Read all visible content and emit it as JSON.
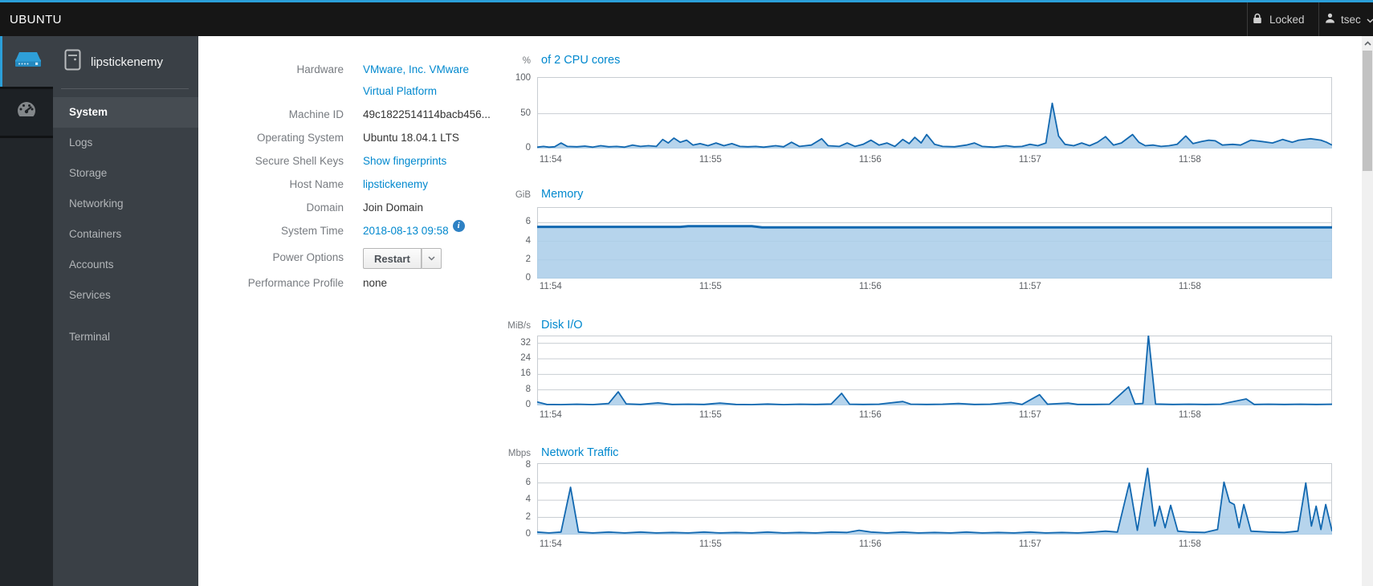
{
  "topbar": {
    "brand": "UBUNTU",
    "locked_label": "Locked",
    "user_label": "tsec"
  },
  "sidebar": {
    "host": "lipstickenemy",
    "items": [
      {
        "label": "System",
        "active": true
      },
      {
        "label": "Logs"
      },
      {
        "label": "Storage"
      },
      {
        "label": "Networking"
      },
      {
        "label": "Containers"
      },
      {
        "label": "Accounts"
      },
      {
        "label": "Services"
      },
      {
        "label": "Terminal",
        "separated": true
      }
    ]
  },
  "system": {
    "rows": [
      {
        "name": "hardware",
        "label": "Hardware",
        "value": "VMware, Inc. VMware Virtual Platform",
        "type": "link",
        "wrap": true
      },
      {
        "name": "machine-id",
        "label": "Machine ID",
        "value": "49c1822514114bacb456...",
        "type": "text"
      },
      {
        "name": "operating-system",
        "label": "Operating System",
        "value": "Ubuntu 18.04.1 LTS",
        "type": "text"
      },
      {
        "name": "secure-shell-keys",
        "label": "Secure Shell Keys",
        "value": "Show fingerprints",
        "type": "link"
      },
      {
        "name": "host-name",
        "label": "Host Name",
        "value": "lipstickenemy",
        "type": "link"
      },
      {
        "name": "domain",
        "label": "Domain",
        "value": "Join Domain",
        "type": "text"
      },
      {
        "name": "system-time",
        "label": "System Time",
        "value": "2018-08-13 09:58",
        "type": "link",
        "info_icon": true
      },
      {
        "name": "power-options",
        "label": "Power Options",
        "value": "Restart",
        "type": "button"
      },
      {
        "name": "performance-profile",
        "label": "Performance Profile",
        "value": "none",
        "type": "text"
      }
    ]
  },
  "colors": {
    "accent": "#2b9fd9",
    "link": "#0088ce",
    "chart_line": "#1268b0",
    "chart_fill": "#a9cce9",
    "chart_grid": "#c9ced3",
    "chart_border": "#c8cdd2"
  },
  "chart_data": [
    {
      "type": "area",
      "unit": "%",
      "title": "of 2 CPU cores",
      "ylim": [
        0,
        102.5
      ],
      "yticks": [
        100,
        50,
        0
      ],
      "gridlines": [
        50
      ],
      "line_width": 1.8,
      "xticks": {
        "labels": [
          "11:54",
          "11:55",
          "11:56",
          "11:57",
          "11:58"
        ],
        "t": [
          0.017,
          0.218,
          0.419,
          0.62,
          0.821
        ]
      },
      "series": [
        [
          0,
          2
        ],
        [
          0.008,
          3
        ],
        [
          0.015,
          2
        ],
        [
          0.022,
          2.5
        ],
        [
          0.03,
          8
        ],
        [
          0.038,
          3
        ],
        [
          0.05,
          2.5
        ],
        [
          0.06,
          3.5
        ],
        [
          0.07,
          2
        ],
        [
          0.08,
          4
        ],
        [
          0.09,
          2.5
        ],
        [
          0.1,
          3
        ],
        [
          0.11,
          2
        ],
        [
          0.12,
          5
        ],
        [
          0.13,
          3
        ],
        [
          0.14,
          4
        ],
        [
          0.15,
          3
        ],
        [
          0.158,
          13
        ],
        [
          0.165,
          8
        ],
        [
          0.172,
          15
        ],
        [
          0.18,
          9
        ],
        [
          0.188,
          12
        ],
        [
          0.196,
          5
        ],
        [
          0.205,
          7
        ],
        [
          0.215,
          4
        ],
        [
          0.225,
          8
        ],
        [
          0.235,
          4
        ],
        [
          0.245,
          7
        ],
        [
          0.255,
          3
        ],
        [
          0.265,
          2.5
        ],
        [
          0.275,
          3
        ],
        [
          0.285,
          2
        ],
        [
          0.3,
          4
        ],
        [
          0.31,
          2.5
        ],
        [
          0.32,
          9
        ],
        [
          0.33,
          3
        ],
        [
          0.345,
          5
        ],
        [
          0.358,
          14
        ],
        [
          0.366,
          4
        ],
        [
          0.38,
          3
        ],
        [
          0.39,
          8
        ],
        [
          0.4,
          3
        ],
        [
          0.41,
          6
        ],
        [
          0.42,
          12
        ],
        [
          0.43,
          5
        ],
        [
          0.44,
          8
        ],
        [
          0.45,
          3
        ],
        [
          0.46,
          13
        ],
        [
          0.468,
          7
        ],
        [
          0.475,
          16
        ],
        [
          0.483,
          8
        ],
        [
          0.49,
          20
        ],
        [
          0.5,
          6
        ],
        [
          0.51,
          3
        ],
        [
          0.525,
          2.5
        ],
        [
          0.54,
          5
        ],
        [
          0.55,
          8
        ],
        [
          0.56,
          3
        ],
        [
          0.575,
          2
        ],
        [
          0.59,
          4
        ],
        [
          0.6,
          2.5
        ],
        [
          0.61,
          3
        ],
        [
          0.62,
          6
        ],
        [
          0.63,
          4
        ],
        [
          0.64,
          8
        ],
        [
          0.648,
          65
        ],
        [
          0.656,
          18
        ],
        [
          0.664,
          6
        ],
        [
          0.675,
          4
        ],
        [
          0.685,
          8
        ],
        [
          0.695,
          4
        ],
        [
          0.705,
          9
        ],
        [
          0.715,
          17
        ],
        [
          0.725,
          5
        ],
        [
          0.735,
          8
        ],
        [
          0.749,
          20
        ],
        [
          0.757,
          9
        ],
        [
          0.765,
          4
        ],
        [
          0.775,
          5
        ],
        [
          0.785,
          3
        ],
        [
          0.795,
          4
        ],
        [
          0.805,
          6
        ],
        [
          0.816,
          18
        ],
        [
          0.825,
          7
        ],
        [
          0.836,
          10
        ],
        [
          0.845,
          12
        ],
        [
          0.853,
          11
        ],
        [
          0.862,
          5
        ],
        [
          0.875,
          6
        ],
        [
          0.885,
          5
        ],
        [
          0.898,
          12
        ],
        [
          0.912,
          10
        ],
        [
          0.925,
          8
        ],
        [
          0.938,
          13
        ],
        [
          0.95,
          9
        ],
        [
          0.958,
          12
        ],
        [
          0.973,
          14
        ],
        [
          0.986,
          12
        ],
        [
          0.993,
          9
        ],
        [
          1,
          5
        ]
      ]
    },
    {
      "type": "area",
      "unit": "GiB",
      "title": "Memory",
      "ylim": [
        0,
        7.67
      ],
      "yticks": [
        6,
        4,
        2,
        0
      ],
      "gridlines": [
        6,
        4,
        2
      ],
      "line_width": 3,
      "xticks": {
        "labels": [
          "11:54",
          "11:55",
          "11:56",
          "11:57",
          "11:58"
        ],
        "t": [
          0.017,
          0.218,
          0.419,
          0.62,
          0.821
        ]
      },
      "series": [
        [
          0,
          5.55
        ],
        [
          0.18,
          5.55
        ],
        [
          0.19,
          5.62
        ],
        [
          0.27,
          5.62
        ],
        [
          0.283,
          5.5
        ],
        [
          0.6,
          5.5
        ],
        [
          1,
          5.5
        ]
      ]
    },
    {
      "type": "area",
      "unit": "MiB/s",
      "title": "Disk I/O",
      "ylim": [
        0,
        36
      ],
      "yticks": [
        32,
        24,
        16,
        8,
        0
      ],
      "gridlines": [
        32,
        24,
        16,
        8
      ],
      "line_width": 1.8,
      "xticks": {
        "labels": [
          "11:54",
          "11:55",
          "11:56",
          "11:57",
          "11:58"
        ],
        "t": [
          0.017,
          0.218,
          0.419,
          0.62,
          0.821
        ]
      },
      "series": [
        [
          0,
          1.8
        ],
        [
          0.012,
          0.5
        ],
        [
          0.03,
          0.4
        ],
        [
          0.05,
          0.6
        ],
        [
          0.07,
          0.4
        ],
        [
          0.09,
          1
        ],
        [
          0.102,
          7
        ],
        [
          0.112,
          0.8
        ],
        [
          0.13,
          0.5
        ],
        [
          0.152,
          1.3
        ],
        [
          0.17,
          0.5
        ],
        [
          0.19,
          0.6
        ],
        [
          0.21,
          0.5
        ],
        [
          0.23,
          1.2
        ],
        [
          0.25,
          0.5
        ],
        [
          0.27,
          0.4
        ],
        [
          0.29,
          0.7
        ],
        [
          0.31,
          0.4
        ],
        [
          0.33,
          0.6
        ],
        [
          0.35,
          0.5
        ],
        [
          0.37,
          0.7
        ],
        [
          0.383,
          6.2
        ],
        [
          0.393,
          0.6
        ],
        [
          0.41,
          0.5
        ],
        [
          0.43,
          0.6
        ],
        [
          0.46,
          2
        ],
        [
          0.47,
          0.6
        ],
        [
          0.49,
          0.5
        ],
        [
          0.51,
          0.6
        ],
        [
          0.53,
          1
        ],
        [
          0.55,
          0.5
        ],
        [
          0.57,
          0.6
        ],
        [
          0.596,
          1.5
        ],
        [
          0.61,
          0.5
        ],
        [
          0.632,
          5.5
        ],
        [
          0.642,
          0.6
        ],
        [
          0.668,
          1.2
        ],
        [
          0.68,
          0.5
        ],
        [
          0.7,
          0.5
        ],
        [
          0.72,
          0.6
        ],
        [
          0.744,
          9.5
        ],
        [
          0.752,
          0.8
        ],
        [
          0.762,
          1
        ],
        [
          0.769,
          36
        ],
        [
          0.778,
          0.7
        ],
        [
          0.8,
          0.5
        ],
        [
          0.82,
          0.6
        ],
        [
          0.84,
          0.5
        ],
        [
          0.86,
          0.6
        ],
        [
          0.892,
          3.3
        ],
        [
          0.902,
          0.5
        ],
        [
          0.92,
          0.6
        ],
        [
          0.94,
          0.5
        ],
        [
          0.96,
          0.6
        ],
        [
          0.98,
          0.5
        ],
        [
          1,
          0.6
        ]
      ]
    },
    {
      "type": "area",
      "unit": "Mbps",
      "title": "Network Traffic",
      "ylim": [
        0,
        8.3
      ],
      "yticks": [
        8,
        6,
        4,
        2,
        0
      ],
      "gridlines": [
        6,
        4,
        2
      ],
      "line_width": 1.8,
      "xticks": {
        "labels": [
          "11:54",
          "11:55",
          "11:56",
          "11:57",
          "11:58"
        ],
        "t": [
          0.017,
          0.218,
          0.419,
          0.62,
          0.821
        ]
      },
      "series": [
        [
          0,
          0.3
        ],
        [
          0.015,
          0.2
        ],
        [
          0.03,
          0.3
        ],
        [
          0.042,
          5.5
        ],
        [
          0.052,
          0.3
        ],
        [
          0.07,
          0.2
        ],
        [
          0.09,
          0.3
        ],
        [
          0.11,
          0.2
        ],
        [
          0.13,
          0.3
        ],
        [
          0.15,
          0.2
        ],
        [
          0.17,
          0.25
        ],
        [
          0.19,
          0.2
        ],
        [
          0.21,
          0.3
        ],
        [
          0.23,
          0.2
        ],
        [
          0.25,
          0.25
        ],
        [
          0.27,
          0.2
        ],
        [
          0.29,
          0.3
        ],
        [
          0.31,
          0.2
        ],
        [
          0.33,
          0.25
        ],
        [
          0.35,
          0.2
        ],
        [
          0.37,
          0.3
        ],
        [
          0.39,
          0.25
        ],
        [
          0.405,
          0.5
        ],
        [
          0.42,
          0.3
        ],
        [
          0.44,
          0.2
        ],
        [
          0.46,
          0.3
        ],
        [
          0.48,
          0.2
        ],
        [
          0.5,
          0.25
        ],
        [
          0.52,
          0.2
        ],
        [
          0.54,
          0.3
        ],
        [
          0.56,
          0.2
        ],
        [
          0.58,
          0.25
        ],
        [
          0.6,
          0.2
        ],
        [
          0.62,
          0.3
        ],
        [
          0.64,
          0.2
        ],
        [
          0.66,
          0.25
        ],
        [
          0.68,
          0.2
        ],
        [
          0.7,
          0.3
        ],
        [
          0.715,
          0.4
        ],
        [
          0.73,
          0.3
        ],
        [
          0.745,
          6
        ],
        [
          0.755,
          0.5
        ],
        [
          0.768,
          7.7
        ],
        [
          0.777,
          1
        ],
        [
          0.783,
          3.3
        ],
        [
          0.79,
          0.8
        ],
        [
          0.797,
          3.4
        ],
        [
          0.806,
          0.4
        ],
        [
          0.82,
          0.3
        ],
        [
          0.84,
          0.25
        ],
        [
          0.856,
          0.6
        ],
        [
          0.864,
          6.1
        ],
        [
          0.871,
          3.8
        ],
        [
          0.877,
          3.5
        ],
        [
          0.883,
          0.8
        ],
        [
          0.889,
          3.5
        ],
        [
          0.898,
          0.4
        ],
        [
          0.92,
          0.3
        ],
        [
          0.94,
          0.25
        ],
        [
          0.957,
          0.4
        ],
        [
          0.967,
          6
        ],
        [
          0.974,
          1
        ],
        [
          0.98,
          3.3
        ],
        [
          0.986,
          0.6
        ],
        [
          0.992,
          3.5
        ],
        [
          1,
          0.4
        ]
      ]
    }
  ]
}
